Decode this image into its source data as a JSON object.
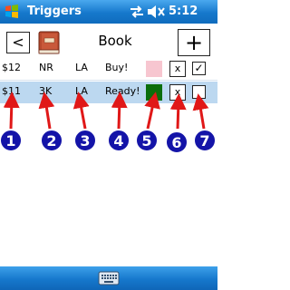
{
  "titlebar": {
    "title": "Triggers",
    "time": "5:12",
    "start_icon": "windows-flag-icon",
    "connectivity_icon": "connectivity-arrows-icon",
    "volume_icon": "speaker-muted-icon"
  },
  "toolbar": {
    "back_label": "<",
    "book_icon": "book-icon",
    "title": "Book",
    "add_label": "+"
  },
  "rows": [
    {
      "price": "$12",
      "code": "NR",
      "location": "LA",
      "action": "Buy!",
      "swatch_color": "#f7c6d0",
      "delete_label": "x",
      "checked": true,
      "check_mark": "✓"
    },
    {
      "price": "$11",
      "code": "3K",
      "location": "LA",
      "action": "Ready!",
      "swatch_color": "#0b6e0b",
      "delete_label": "x",
      "checked": false,
      "check_mark": ""
    }
  ],
  "callouts": [
    "1",
    "2",
    "3",
    "4",
    "5",
    "6",
    "7"
  ],
  "colors": {
    "titlebar": "#1678cc",
    "selected_row": "#bcd8f0",
    "callout_fill": "#1414a8",
    "callout_arrow": "#e01818"
  },
  "bottombar": {
    "keyboard_icon": "keyboard-icon"
  }
}
